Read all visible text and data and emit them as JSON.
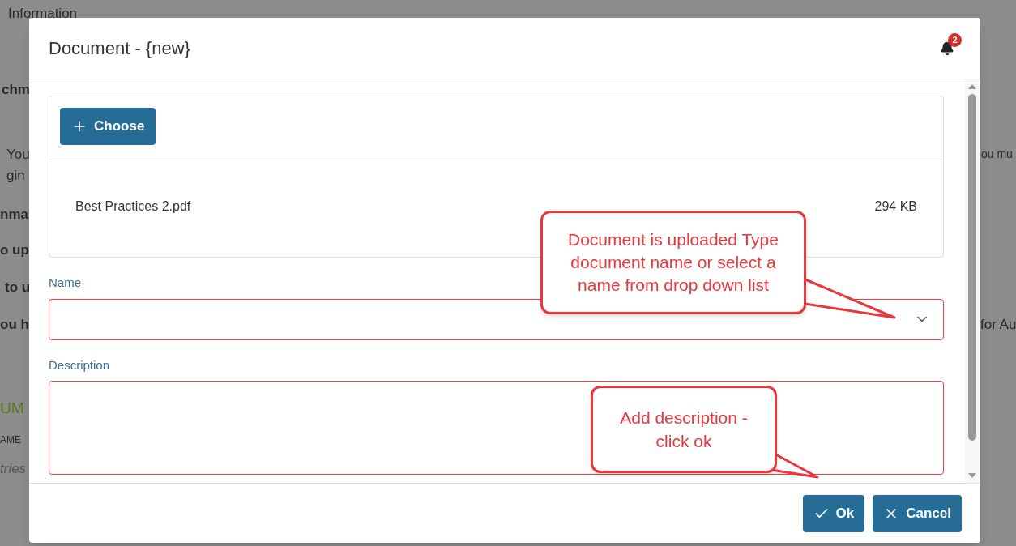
{
  "background_page": {
    "fragments": [
      {
        "text": "Information"
      },
      {
        "text": "chm"
      },
      {
        "text": "You"
      },
      {
        "text": "gin"
      },
      {
        "text": "nma"
      },
      {
        "text": "o up"
      },
      {
        "text": "to u"
      },
      {
        "text": "ou h"
      },
      {
        "text": "UM"
      },
      {
        "text": "AME"
      },
      {
        "text": "tries"
      },
      {
        "text": "ou mu"
      },
      {
        "text": "for Au"
      }
    ]
  },
  "dialog": {
    "title": "Document - {new}",
    "notifications": {
      "count": "2"
    },
    "upload": {
      "choose_button": "Choose",
      "file": {
        "name": "Best Practices 2.pdf",
        "size": "294 KB"
      }
    },
    "fields": [
      {
        "label": "Name",
        "kind": "select",
        "invalid": true
      },
      {
        "label": "Description",
        "kind": "textarea",
        "invalid": true
      }
    ],
    "buttons": [
      {
        "label": "Ok"
      },
      {
        "label": "Cancel"
      }
    ]
  },
  "callouts": [
    {
      "text": "Document is uploaded Type document name or select a name from drop down list"
    },
    {
      "text": "Add description - click ok"
    }
  ]
}
